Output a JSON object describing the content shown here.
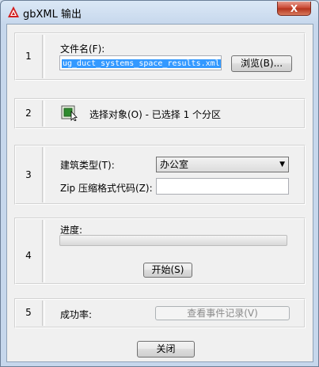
{
  "window": {
    "title": "gbXML 输出",
    "close_label": "X"
  },
  "sections": {
    "s1": {
      "number": "1",
      "filename_label": "文件名(F):",
      "filename_value": "ug_duct_systems_space_results.xml",
      "browse_label": "浏览(B)..."
    },
    "s2": {
      "number": "2",
      "select_text": "选择对象(O) - 已选择 1 个分区"
    },
    "s3": {
      "number": "3",
      "building_type_label": "建筑类型(T):",
      "building_type_value": "办公室",
      "zip_label": "Zip 压缩格式代码(Z):",
      "zip_value": ""
    },
    "s4": {
      "number": "4",
      "progress_label": "进度:",
      "progress_fraction": 0,
      "start_label": "开始(S)"
    },
    "s5": {
      "number": "5",
      "success_label": "成功率:",
      "view_log_label": "查看事件记录(V)"
    }
  },
  "footer": {
    "close_label": "关闭"
  }
}
